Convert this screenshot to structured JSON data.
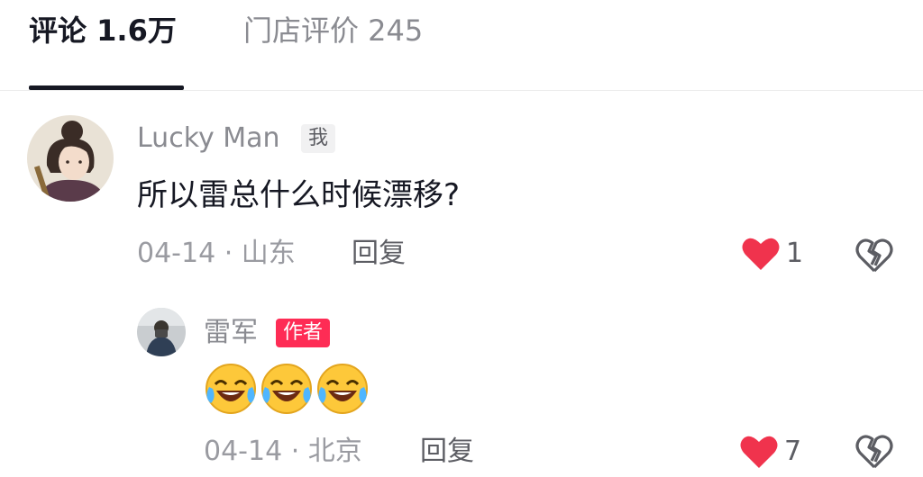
{
  "tabs": [
    {
      "label": "评论 1.6万"
    },
    {
      "label": "门店评价 245"
    }
  ],
  "comments": [
    {
      "username": "Lucky Man",
      "tag": "我",
      "text": "所以雷总什么时候漂移?",
      "date_location": "04-14 · 山东",
      "reply_label": "回复",
      "like_count": "1",
      "avatar_icon": "anime-girl-avatar"
    },
    {
      "username": "雷军",
      "tag": "作者",
      "emojis": [
        "laughing-crying-emoji",
        "laughing-crying-emoji",
        "laughing-crying-emoji"
      ],
      "date_location": "04-14 · 北京",
      "reply_label": "回复",
      "like_count": "7",
      "avatar_icon": "person-photo-avatar"
    }
  ],
  "colors": {
    "like_red": "#f0334d",
    "author_tag": "#fe2c55",
    "muted_text": "#8a8b91"
  }
}
